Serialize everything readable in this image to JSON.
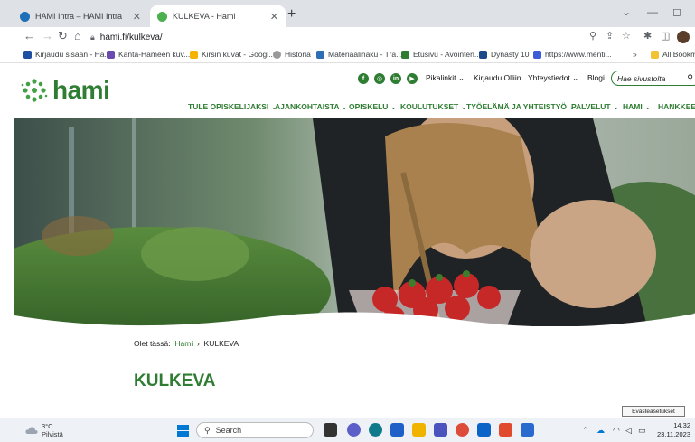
{
  "browser": {
    "tabs": [
      {
        "label": "HAMI Intra – HAMI Intra",
        "close": "✕",
        "active": false
      },
      {
        "label": "KULKEVA - Hami",
        "close": "✕",
        "active": true
      }
    ],
    "new_tab": "+",
    "url": "hami.fi/kulkeva/",
    "bookmarks": [
      "Kirjaudu sisään - Hä...",
      "Kanta-Hämeen kuv...",
      "Kirsin kuvat - Googl...",
      "Historia",
      "Materiaalihaku - Tra...",
      "Etusivu - Avointen...",
      "Dynasty 10",
      "https://www.menti...",
      "All Bookmarks"
    ],
    "bookmarks_more": "»"
  },
  "site": {
    "logo_text": "hami",
    "social_icons": [
      "facebook-icon",
      "instagram-icon",
      "linkedin-icon",
      "youtube-icon"
    ],
    "utility_nav": [
      "Pikalinkit ⌄",
      "Kirjaudu Olliin",
      "Yhteystiedot ⌄",
      "Blogi"
    ],
    "search_placeholder": "Hae sivustolta",
    "main_nav": [
      "TULE OPISKELIJAKSI ⌄",
      "AJANKOHTAISTA ⌄",
      "OPISKELU ⌄",
      "KOULUTUKSET ⌄",
      "TYÖELÄMÄ JA YHTEISTYÖ ⌄",
      "PALVELUT ⌄",
      "HAMI ⌄",
      "HANKKEET"
    ]
  },
  "breadcrumb": {
    "label": "Olet tässä:",
    "home": "Hami",
    "separator": "›",
    "current": "KULKEVA"
  },
  "page_title": "KULKEVA",
  "cookie_tooltip": "Evästeasetukset",
  "taskbar": {
    "weather_temp": "3°C",
    "weather_desc": "Pilvistä",
    "search_label": "Search",
    "time": "14.32",
    "date": "23.11.2023"
  },
  "colors": {
    "brand_green": "#2e7d32",
    "tab_bar": "#dee1e6",
    "taskbar": "#eef1f6"
  }
}
